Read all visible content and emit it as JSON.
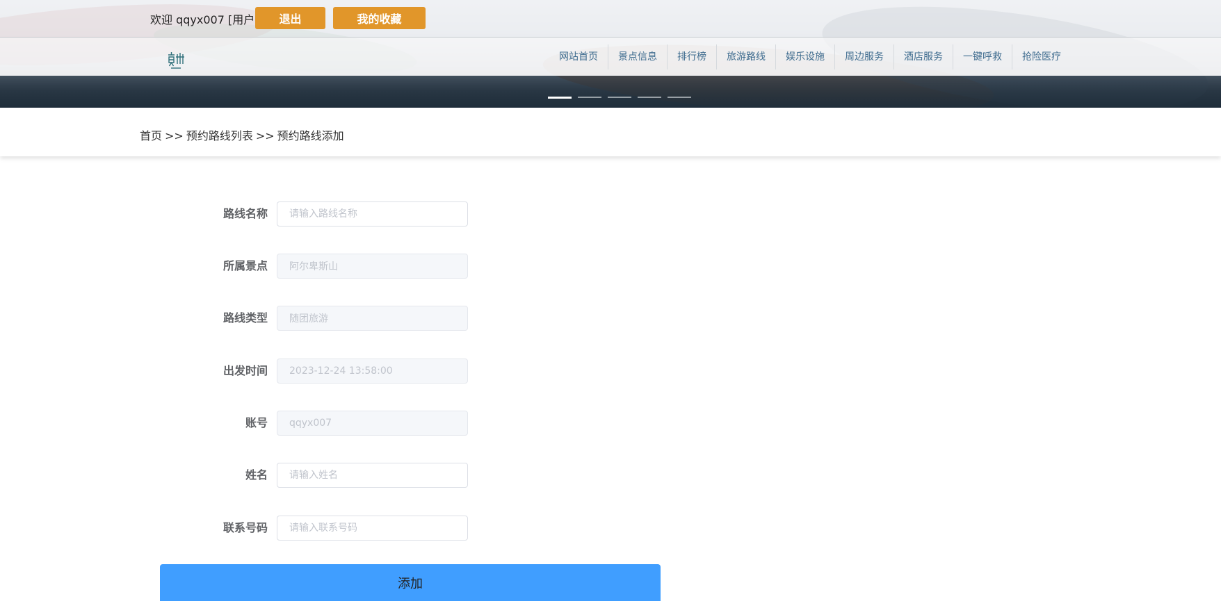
{
  "header": {
    "welcome": "欢迎 qqyx007 [用户]",
    "logout_label": "退出",
    "favorites_label": "我的收藏"
  },
  "nav": {
    "items": [
      "网站首页",
      "景点信息",
      "排行榜",
      "旅游路线",
      "娱乐设施",
      "周边服务",
      "酒店服务",
      "一键呼救",
      "抢险医疗"
    ]
  },
  "carousel": {
    "slide_count": 5,
    "active_index": 0
  },
  "breadcrumb": {
    "home": "首页",
    "sep1": ">>",
    "list": "预约路线列表",
    "sep2": ">>",
    "current": "预约路线添加"
  },
  "form": {
    "route_name": {
      "label": "路线名称",
      "placeholder": "请输入路线名称",
      "value": ""
    },
    "scenic_spot": {
      "label": "所属景点",
      "value": "阿尔卑斯山"
    },
    "route_type": {
      "label": "路线类型",
      "value": "随团旅游"
    },
    "departure_time": {
      "label": "出发时间",
      "value": "2023-12-24 13:58:00"
    },
    "account": {
      "label": "账号",
      "value": "qqyx007"
    },
    "name": {
      "label": "姓名",
      "placeholder": "请输入姓名",
      "value": ""
    },
    "phone": {
      "label": "联系号码",
      "placeholder": "请输入联系号码",
      "value": ""
    },
    "submit_label": "添加"
  },
  "colors": {
    "orange_button": "#e1962a",
    "nav_text": "#3f6c8f",
    "submit_button": "#409eff",
    "label_text": "#606266"
  }
}
